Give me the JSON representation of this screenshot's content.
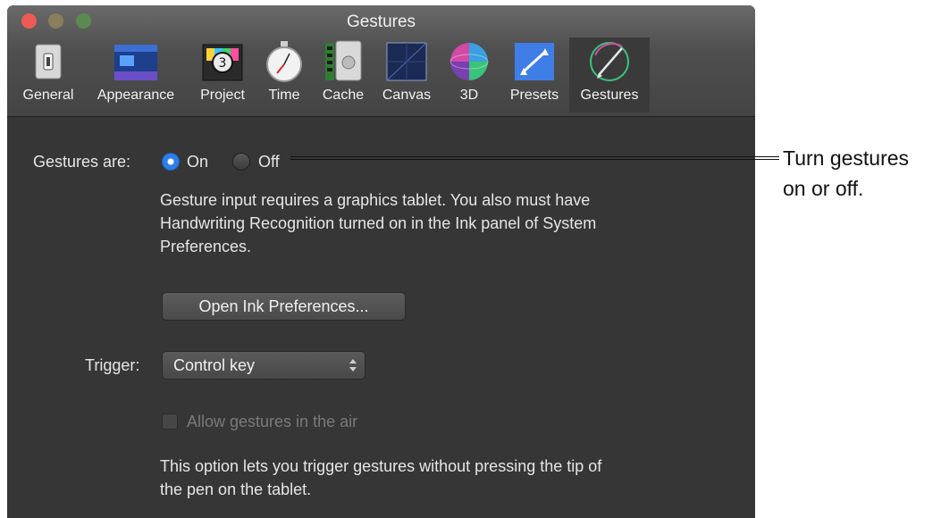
{
  "window": {
    "title": "Gestures"
  },
  "toolbar": {
    "items": [
      {
        "label": "General",
        "icon": "general-switch-icon"
      },
      {
        "label": "Appearance",
        "icon": "appearance-icon"
      },
      {
        "label": "Project",
        "icon": "project-clapper-icon"
      },
      {
        "label": "Time",
        "icon": "stopwatch-icon"
      },
      {
        "label": "Cache",
        "icon": "cache-icon"
      },
      {
        "label": "Canvas",
        "icon": "canvas-grid-icon"
      },
      {
        "label": "3D",
        "icon": "3d-sphere-icon"
      },
      {
        "label": "Presets",
        "icon": "presets-icon"
      },
      {
        "label": "Gestures",
        "icon": "gestures-pen-icon",
        "selected": true
      }
    ]
  },
  "gestures": {
    "label": "Gestures are:",
    "on_label": "On",
    "off_label": "Off",
    "selected": "On",
    "info_lines": [
      "Gesture input requires a graphics tablet. You also must have",
      "Handwriting Recognition turned on in the Ink panel of System",
      "Preferences."
    ],
    "open_ink_button": "Open Ink Preferences..."
  },
  "trigger": {
    "label": "Trigger:",
    "value": "Control key"
  },
  "air": {
    "checkbox_label": "Allow gestures in the air",
    "checked": false,
    "enabled": false,
    "info_lines": [
      "This option lets you trigger gestures without pressing the tip of",
      "the pen on the tablet."
    ]
  },
  "callout": {
    "lines": [
      "Turn gestures",
      "on or off."
    ]
  },
  "colors": {
    "window_bg": "#363636",
    "toolbar_bg": "#4f4f4f",
    "radio_selected": "#2f7de9",
    "close": "#ee5a55"
  }
}
